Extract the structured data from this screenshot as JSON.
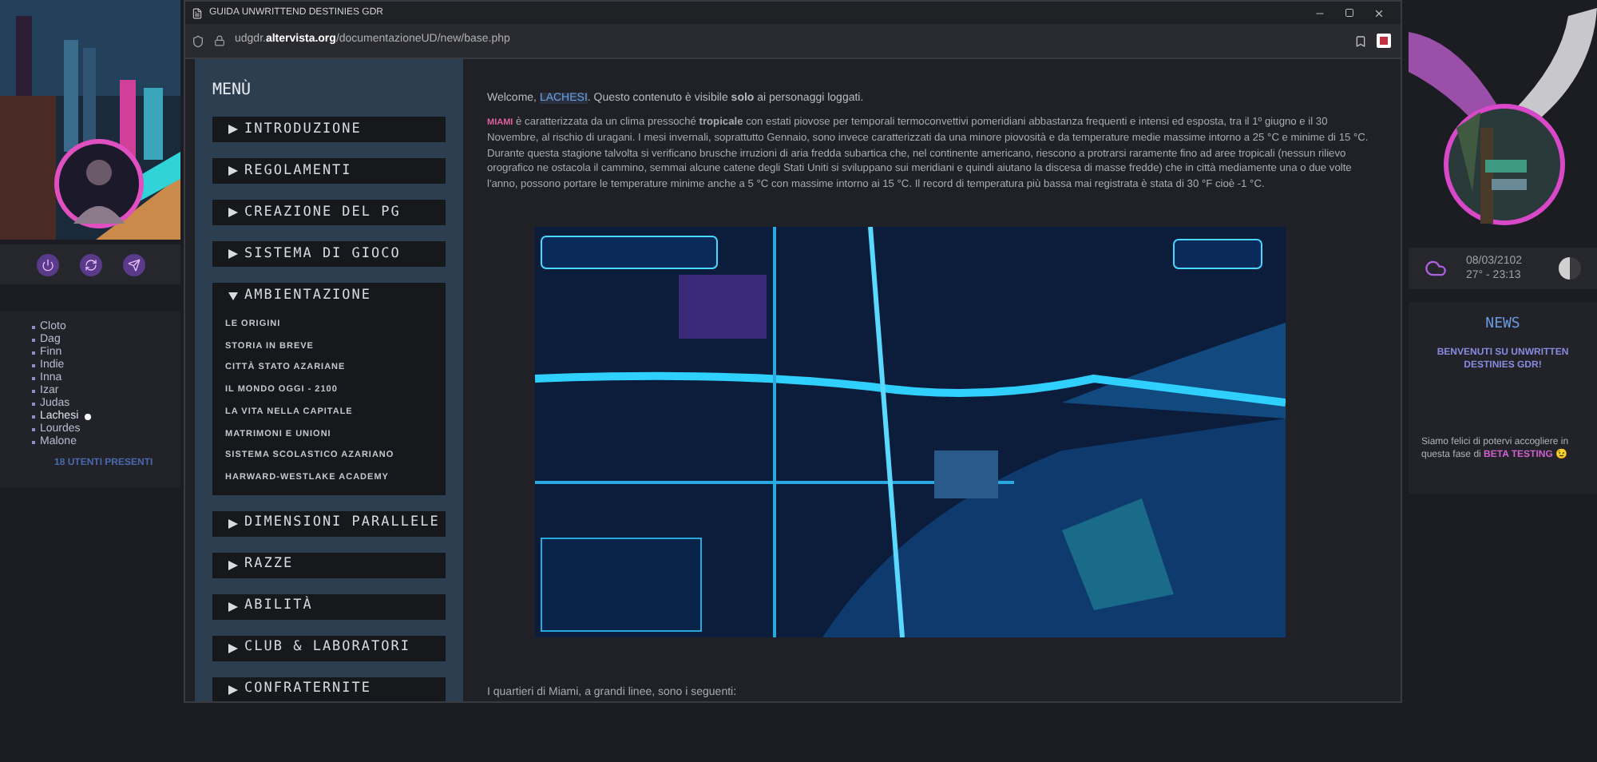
{
  "left_panel": {
    "users": [
      {
        "name": "Cloto",
        "current": false
      },
      {
        "name": "Dag",
        "current": false
      },
      {
        "name": "Finn",
        "current": false
      },
      {
        "name": "Indie",
        "current": false
      },
      {
        "name": "Inna",
        "current": false
      },
      {
        "name": "Izar",
        "current": false
      },
      {
        "name": "Judas",
        "current": false
      },
      {
        "name": "Lachesi",
        "current": true
      },
      {
        "name": "Lourdes",
        "current": false
      },
      {
        "name": "Malone",
        "current": false
      }
    ],
    "online_count": "18 UTENTI PRESENTI"
  },
  "browser": {
    "title": "GUIDA UNWRITTEND DESTINIES GDR",
    "url": {
      "subdomain": "udgdr.",
      "domain": "altervista.org",
      "path": "/documentazioneUD/new/base.php"
    }
  },
  "menu": {
    "title": "MENÙ",
    "sections": [
      {
        "label": "INTRODUZIONE",
        "expanded": false
      },
      {
        "label": "REGOLAMENTI",
        "expanded": false
      },
      {
        "label": "CREAZIONE DEL PG",
        "expanded": false
      },
      {
        "label": "SISTEMA DI GIOCO",
        "expanded": false
      },
      {
        "label": "AMBIENTAZIONE",
        "expanded": true,
        "children": [
          "LE ORIGINI",
          "STORIA IN BREVE",
          "CITTÀ STATO AZARIANE",
          "IL MONDO OGGI - 2100",
          "LA VITA NELLA CAPITALE",
          "MATRIMONI E UNIONI",
          "SISTEMA SCOLASTICO AZARIANO",
          "HARWARD-WESTLAKE ACADEMY"
        ]
      },
      {
        "label": "DIMENSIONI PARALLELE",
        "expanded": false
      },
      {
        "label": "RAZZE",
        "expanded": false
      },
      {
        "label": "ABILITÀ",
        "expanded": false
      },
      {
        "label": "CLUB & LABORATORI",
        "expanded": false
      },
      {
        "label": "CONFRATERNITE",
        "expanded": false
      }
    ]
  },
  "content": {
    "welcome": {
      "prefix": "Welcome, ",
      "user": "LACHESI",
      "suffix": ". Questo contenuto è visibile **solo** ai personaggi loggati."
    },
    "intro": {
      "lead": "MIAMI",
      "text": " è caratterizzata da un clima pressoché **tropicale** con estati piovose per temporali termoconvettivi pomeridiani abbastanza frequenti e intensi ed esposta, tra il 1º giugno e il 30 Novembre, al rischio di uragani. I mesi invernali, soprattutto Gennaio, sono invece caratterizzati da una minore piovosità e da temperature medie massime intorno a 25 °C e minime di 15 °C. Durante questa stagione talvolta si verificano brusche irruzioni di aria fredda subartica che, nel continente americano, riescono a protrarsi raramente fino ad aree tropicali (nessun rilievo orografico ne ostacola il cammino, semmai alcune catene degli Stati Uniti si sviluppano sui meridiani e quindi aiutano la discesa di masse fredde) che in città mediamente una o due volte l'anno, possono portare le temperature minime anche a 5 °C con massime intorno ai 15 °C. Il record di temperatura più bassa mai registrata è stata di 30 °F cioè -1 °C."
    },
    "outro": "I quartieri di Miami, a grandi linee, sono i seguenti:"
  },
  "right_panel": {
    "date": "08/03/2102",
    "weather": "27° - 23:13",
    "news": {
      "title": "NEWS",
      "headline": "BENVENUTI SU UNWRITTEN DESTINIES GDR!",
      "body_prefix": "Siamo felici di potervi accogliere in questa fase di ",
      "highlight": "BETA TESTING",
      "emoji": "😉"
    }
  }
}
